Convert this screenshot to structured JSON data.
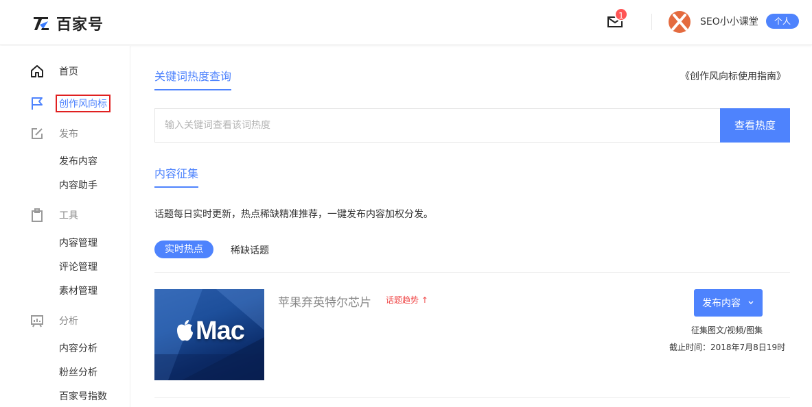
{
  "header": {
    "logo_text": "百家号",
    "mail_badge": "1",
    "user_name": "SEO小小课堂",
    "user_tag": "个人",
    "avatar_color": "#e46b3f"
  },
  "sidebar": {
    "items": [
      {
        "label": "首页",
        "icon": "home-icon"
      },
      {
        "label": "创作风向标",
        "icon": "flag-icon"
      },
      {
        "label": "发布",
        "icon": "edit-icon"
      },
      {
        "label": "工具",
        "icon": "clipboard-icon"
      },
      {
        "label": "分析",
        "icon": "chart-board-icon"
      }
    ],
    "publish_sub": [
      "发布内容",
      "内容助手"
    ],
    "tools_sub": [
      "内容管理",
      "评论管理",
      "素材管理"
    ],
    "analysis_sub": [
      "内容分析",
      "粉丝分析",
      "百家号指数"
    ]
  },
  "main": {
    "keyword_tab": "关键词热度查询",
    "guide_link": "《创作风向标使用指南》",
    "search_placeholder": "输入关键词查看该词热度",
    "search_button": "查看热度",
    "collect_tab": "内容征集",
    "description": "话题每日实时更新，热点稀缺精准推荐，一键发布内容加权分发。",
    "filters": [
      "实时热点",
      "稀缺话题"
    ],
    "topic": {
      "thumb_text": "Mac",
      "title": "苹果弃英特尔芯片",
      "trend": "话题趋势 ↑",
      "publish_button": "发布内容",
      "collect_types": "征集图文/视频/图集",
      "deadline": "截止时间：2018年7月8日19时"
    }
  },
  "colors": {
    "accent": "#4e83fd",
    "alert": "#f04a4a",
    "highlight_border": "#e02020"
  }
}
